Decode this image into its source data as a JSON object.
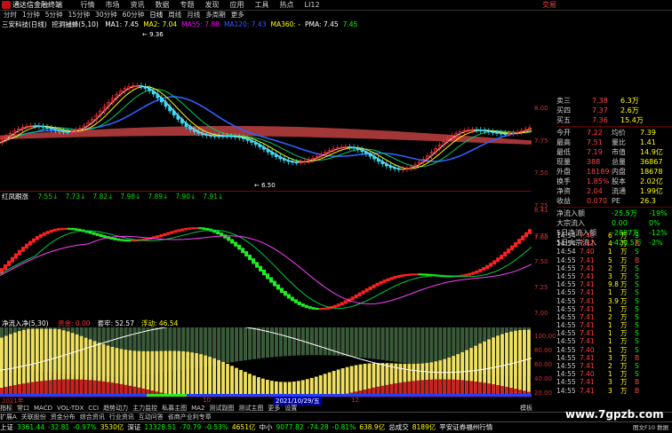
{
  "menu": {
    "app_title": "通达信金融终端",
    "items": [
      "行情",
      "市场",
      "资讯",
      "数据",
      "专题",
      "发现",
      "应用",
      "工具",
      "热点",
      "LI12"
    ],
    "trade_label": "交易"
  },
  "timeframes": [
    "分时",
    "1分钟",
    "5分钟",
    "15分钟",
    "30分钟",
    "60分钟",
    "日线",
    "周线",
    "月线",
    "多周期",
    "更多"
  ],
  "main_chart": {
    "title": "三安科技(日线)",
    "indicator": "挖洞捕蜂(5,10)",
    "ma_labels": [
      {
        "text": "MA1: 7.45",
        "color": "#ffffff"
      },
      {
        "text": "MA2: 7.04",
        "color": "#ffff00"
      },
      {
        "text": "MA55: 7.88",
        "color": "#ff00ff"
      },
      {
        "text": "MA120: 7.43",
        "color": "#3060ff"
      },
      {
        "text": "MA360: -",
        "color": "#ffff00"
      },
      {
        "text": "PMA: 7.45",
        "color": "#ffffff"
      },
      {
        "text": "7.45",
        "color": "#00ff00"
      }
    ],
    "high_mark": "9.36",
    "low_mark": "6.50",
    "y_ticks": [
      "8.00",
      "7.75",
      "7.50",
      "7.25",
      "7.00"
    ]
  },
  "mid_chart": {
    "title": "红凤跟涨",
    "values": [
      "7.55",
      "7.73",
      "7.82",
      "7.98",
      "7.89",
      "7.90",
      "7.91"
    ],
    "y_ticks": [
      "8.41",
      "7.75",
      "7.50",
      "7.25",
      "7.00"
    ]
  },
  "low_chart": {
    "title": "净流入净(5,30)",
    "labels": [
      {
        "text": "资金: 0.00",
        "color": "#ff3333"
      },
      {
        "text": "套牢: 52.57",
        "color": "#ffffff"
      },
      {
        "text": "浮动: 46.54",
        "color": "#ffff00"
      }
    ],
    "y_ticks": [
      "100.00",
      "80.00",
      "60.00",
      "40.00",
      "20.00"
    ]
  },
  "date_label": "2021/10/29/五",
  "axis_labels": [
    "2021年",
    "10",
    "12"
  ],
  "quote": {
    "rows": [
      {
        "l": "卖三",
        "v": "7.38",
        "v2": "6.3万",
        "c": "#ff4040"
      },
      {
        "l": "买四",
        "v": "7.37",
        "v2": "2.6万",
        "c": "#ff4040"
      },
      {
        "l": "买五",
        "v": "7.36",
        "v2": "15.4万",
        "c": "#ff4040"
      }
    ],
    "stats": [
      {
        "l": "今开",
        "v": "7.22",
        "l2": "均价",
        "v2": "7.39"
      },
      {
        "l": "最高",
        "v": "7.51",
        "l2": "量比",
        "v2": "1.41"
      },
      {
        "l": "最低",
        "v": "7.19",
        "l2": "市值",
        "v2": "14.9亿"
      },
      {
        "l": "现量",
        "v": "388",
        "l2": "总量",
        "v2": "36867"
      },
      {
        "l": "外盘",
        "v": "18189",
        "l2": "内盘",
        "v2": "18678"
      },
      {
        "l": "换手",
        "v": "1.85%",
        "l2": "股本",
        "v2": "2.02亿"
      },
      {
        "l": "净资",
        "v": "2.04",
        "l2": "流通",
        "v2": "1.99亿"
      },
      {
        "l": "收益",
        "v": "0.070",
        "l2": "PE",
        "v2": "26.3"
      }
    ],
    "flows": [
      {
        "l": "净流入额",
        "v": "-25.5万",
        "p": "-19%"
      },
      {
        "l": "大宗流入",
        "v": "0.00",
        "p": "0%"
      },
      {
        "l": "5日净流入额",
        "v": "-2887万",
        "p": "-12%"
      },
      {
        "l": "5日大宗流入",
        "v": "-420.5万",
        "p": "-2%"
      }
    ]
  },
  "tape": [
    {
      "t": "14:54",
      "p": "7.40",
      "v": "6",
      "u": "万",
      "s": "S"
    },
    {
      "t": "14:54",
      "p": "7.41",
      "v": "4",
      "u": "万",
      "s": "B"
    },
    {
      "t": "14:54",
      "p": "7.40",
      "v": "1",
      "u": "万",
      "s": "S"
    },
    {
      "t": "14:55",
      "p": "7.41",
      "v": "5",
      "u": "万",
      "s": "B"
    },
    {
      "t": "14:55",
      "p": "7.41",
      "v": "2",
      "u": "万",
      "s": "S"
    },
    {
      "t": "14:55",
      "p": "7.41",
      "v": "3",
      "u": "万",
      "s": "S"
    },
    {
      "t": "14:55",
      "p": "7.41",
      "v": "9.8",
      "u": "万",
      "s": "S"
    },
    {
      "t": "14:55",
      "p": "7.41",
      "v": "1",
      "u": "万",
      "s": "S"
    },
    {
      "t": "14:55",
      "p": "7.41",
      "v": "3.9",
      "u": "万",
      "s": "S"
    },
    {
      "t": "14:55",
      "p": "7.41",
      "v": "1",
      "u": "万",
      "s": "S"
    },
    {
      "t": "14:55",
      "p": "7.41",
      "v": "2",
      "u": "万",
      "s": "S"
    },
    {
      "t": "14:55",
      "p": "7.41",
      "v": "1",
      "u": "万",
      "s": "S"
    },
    {
      "t": "14:55",
      "p": "7.41",
      "v": "1",
      "u": "万",
      "s": "S"
    },
    {
      "t": "14:55",
      "p": "7.41",
      "v": "1",
      "u": "万",
      "s": "S"
    },
    {
      "t": "14:55",
      "p": "7.40",
      "v": "1",
      "u": "万",
      "s": "S"
    },
    {
      "t": "14:55",
      "p": "7.41",
      "v": "3",
      "u": "万",
      "s": "B"
    },
    {
      "t": "14:55",
      "p": "7.41",
      "v": "2",
      "u": "万",
      "s": "S"
    },
    {
      "t": "14:55",
      "p": "7.40",
      "v": "1",
      "u": "万",
      "s": "S"
    },
    {
      "t": "14:55",
      "p": "7.41",
      "v": "3",
      "u": "万",
      "s": "B"
    },
    {
      "t": "14:55",
      "p": "7.41",
      "v": "3",
      "u": "万",
      "s": "B"
    }
  ],
  "bottom_tabs": [
    "指标",
    "常口",
    "MACD",
    "VOL-TDX",
    "CCI",
    "趋势动力",
    "主力监控",
    "私募主图",
    "MA2",
    "测试副图",
    "测试主图",
    "更多",
    "设置"
  ],
  "bottom_tabs2": [
    "扩展A",
    "关联股份",
    "资金分布",
    "综合资讯",
    "行业资讯",
    "互动问答",
    "省商产业利专章"
  ],
  "right_mini": [
    "模板",
    "+"
  ],
  "status": [
    {
      "t": "上证",
      "c": "#ffffff"
    },
    {
      "t": "3361.44",
      "c": "#00ff00"
    },
    {
      "t": "-32.81",
      "c": "#00ff00"
    },
    {
      "t": "-0.97%",
      "c": "#00ff00"
    },
    {
      "t": "3530亿",
      "c": "#ffff00"
    },
    {
      "t": "深证",
      "c": "#ffffff"
    },
    {
      "t": "13328.51",
      "c": "#00ff00"
    },
    {
      "t": "-70.79",
      "c": "#00ff00"
    },
    {
      "t": "-0.53%",
      "c": "#00ff00"
    },
    {
      "t": "4651亿",
      "c": "#ffff00"
    },
    {
      "t": "中小",
      "c": "#ffffff"
    },
    {
      "t": "9077.82",
      "c": "#00ff00"
    },
    {
      "t": "-74.28",
      "c": "#00ff00"
    },
    {
      "t": "-0.81%",
      "c": "#00ff00"
    },
    {
      "t": "638.9亿",
      "c": "#ffff00"
    },
    {
      "t": "总成交",
      "c": "#ffffff"
    },
    {
      "t": "8189亿",
      "c": "#ffff00"
    },
    {
      "t": "平安证券福州行情",
      "c": "#ffffff"
    }
  ],
  "watermark": "www.7gpzb.com",
  "status_right": "图文F10 数据"
}
